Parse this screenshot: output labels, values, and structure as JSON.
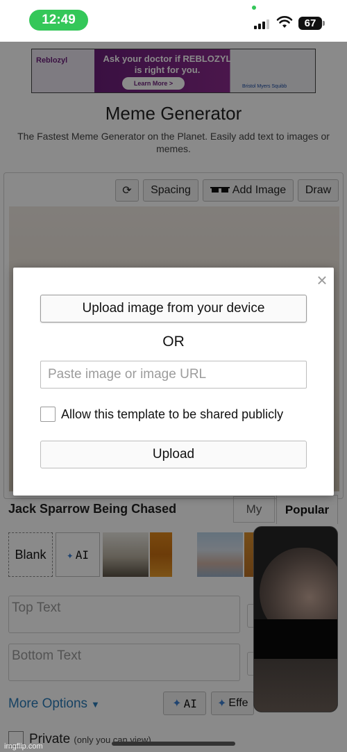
{
  "status_bar": {
    "time": "12:49",
    "battery": "67",
    "time_pill_color": "#34c759"
  },
  "ad": {
    "brand": "Reblozyl",
    "headline": "Ask your doctor if REBLOZYL is right for you.",
    "button": "Learn More >",
    "sponsor": "Bristol Myers Squibb"
  },
  "header": {
    "title": "Meme Generator",
    "subtitle": "The Fastest Meme Generator on the Planet. Easily add text to images or memes."
  },
  "toolbar": {
    "rotate_icon": "rotate-icon",
    "spacing": "Spacing",
    "add_image_icon": "sunglasses-icon",
    "add_image": "Add Image",
    "draw": "Draw"
  },
  "templates": {
    "name": "Jack Sparrow Being Chased",
    "tab_my": "My",
    "tab_popular": "Popular",
    "blank": "Blank",
    "ai": "AI"
  },
  "text_fields": {
    "top_placeholder": "Top Text",
    "bottom_placeholder": "Bottom Text"
  },
  "footer_controls": {
    "more_options": "More Options",
    "ai": "AI",
    "effects": "Effe",
    "private": "Private",
    "private_note": "(only you can view)"
  },
  "watermark": "imgflip.com",
  "modal": {
    "close": "×",
    "upload_device": "Upload image from your device",
    "or": "OR",
    "url_placeholder": "Paste image or image URL",
    "share_label": "Allow this template to be shared publicly",
    "upload": "Upload"
  },
  "colors": {
    "link": "#2a7ab8",
    "overlay": "rgba(0,0,0,0.46)"
  }
}
